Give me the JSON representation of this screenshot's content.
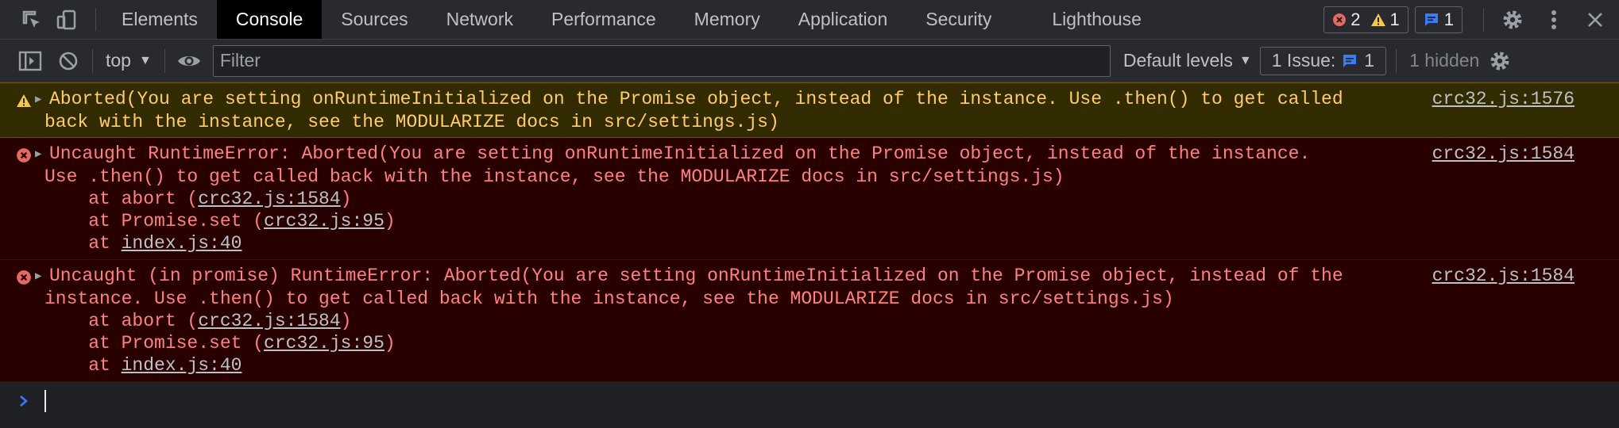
{
  "tabs": [
    "Elements",
    "Console",
    "Sources",
    "Network",
    "Performance",
    "Memory",
    "Application",
    "Security",
    "Lighthouse"
  ],
  "active_tab": "Console",
  "counters": {
    "errors": "2",
    "warnings": "1",
    "messages": "1"
  },
  "toolbar": {
    "context": "top",
    "filter_placeholder": "Filter",
    "filter_value": "",
    "levels": "Default levels",
    "issues_label": "1 Issue:",
    "issues_count": "1",
    "hidden": "1 hidden"
  },
  "messages": [
    {
      "level": "warning",
      "line1": "Aborted(You are setting onRuntimeInitialized on the Promise object, instead of the instance. Use .then() to get called",
      "line2": "back with the instance, see the MODULARIZE docs in src/settings.js)",
      "source": "crc32.js:1576"
    },
    {
      "level": "error",
      "line1": "Uncaught RuntimeError: Aborted(You are setting onRuntimeInitialized on the Promise object, instead of the instance.",
      "line2": "Use .then() to get called back with the instance, see the MODULARIZE docs in src/settings.js)",
      "source": "crc32.js:1584",
      "stack": [
        {
          "prefix": "    at abort (",
          "link": "crc32.js:1584",
          "suffix": ")"
        },
        {
          "prefix": "    at Promise.set (",
          "link": "crc32.js:95",
          "suffix": ")"
        },
        {
          "prefix": "    at ",
          "link": "index.js:40",
          "suffix": ""
        }
      ]
    },
    {
      "level": "error",
      "line1": "Uncaught (in promise) RuntimeError: Aborted(You are setting onRuntimeInitialized on the Promise object, instead of the",
      "line2": "instance. Use .then() to get called back with the instance, see the MODULARIZE docs in src/settings.js)",
      "source": "crc32.js:1584",
      "stack": [
        {
          "prefix": "    at abort (",
          "link": "crc32.js:1584",
          "suffix": ")"
        },
        {
          "prefix": "    at Promise.set (",
          "link": "crc32.js:95",
          "suffix": ")"
        },
        {
          "prefix": "    at ",
          "link": "index.js:40",
          "suffix": ""
        }
      ]
    }
  ],
  "colors": {
    "warning_text": "#ffcb6b",
    "error_text": "#ff8080",
    "accent_blue": "#3b7cf5"
  }
}
